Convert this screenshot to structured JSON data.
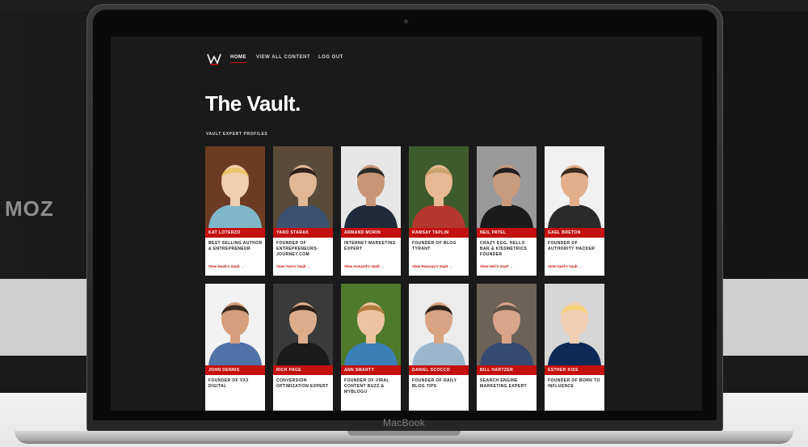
{
  "background": {
    "brand_logo": "MOZ"
  },
  "device": {
    "brand": "MacBook"
  },
  "nav": {
    "logo_icon": "vault-w-logo-icon",
    "home": "HOME",
    "view_all": "VIEW ALL CONTENT",
    "logout": "LOG OUT"
  },
  "page": {
    "title": "The Vault.",
    "section_label": "VAULT EXPERT PROFILES"
  },
  "colors": {
    "accent": "#c4100f",
    "screen_bg": "#1a1a1a",
    "title": "#ffffff"
  },
  "profiles": [
    {
      "name": "KAT LOTERZO",
      "desc": "BEST SELLING AUTHOR & ENTREPRENEUR",
      "link": "View Noah's Vault →"
    },
    {
      "name": "YARO STARAK",
      "desc": "FOUNDER OF ENTREPRENEURS-JOURNEY.COM",
      "link": "View Yaro's Vault →"
    },
    {
      "name": "ARMAND MORIN",
      "desc": "INTERNET MARKETING EXPERT",
      "link": "View Armand's Vault →"
    },
    {
      "name": "RAMSAY TAPLIN",
      "desc": "FOUNDER OF BLOG TYRANT",
      "link": "View Ramsay's Vault →"
    },
    {
      "name": "NEIL PATEL",
      "desc": "CRAZY EGG, HELLO BAR & KISSMETRICS FOUNDER",
      "link": "View Neil's Vault →"
    },
    {
      "name": "GAEL BRETON",
      "desc": "FOUNDER OF AUTHORITY HACKER",
      "link": "View Gael's Vault →"
    },
    {
      "name": "JOHN DENNIS",
      "desc": "FOUNDER OF VX3 DIGITAL",
      "link": ""
    },
    {
      "name": "RICH PAGE",
      "desc": "CONVERSION OPTIMIZATION EXPERT",
      "link": ""
    },
    {
      "name": "ANN SMARTY",
      "desc": "FOUNDER OF VIRAL CONTENT BUZZ & MYBLOGU",
      "link": ""
    },
    {
      "name": "DANIEL SCOCCO",
      "desc": "FOUNDER OF DAILY BLOG TIPS",
      "link": ""
    },
    {
      "name": "BILL HARTZER",
      "desc": "SEARCH ENGINE MARKETING EXPERT",
      "link": ""
    },
    {
      "name": "ESTHER KISS",
      "desc": "FOUNDER OF BORN TO INFLUENCE",
      "link": ""
    }
  ]
}
